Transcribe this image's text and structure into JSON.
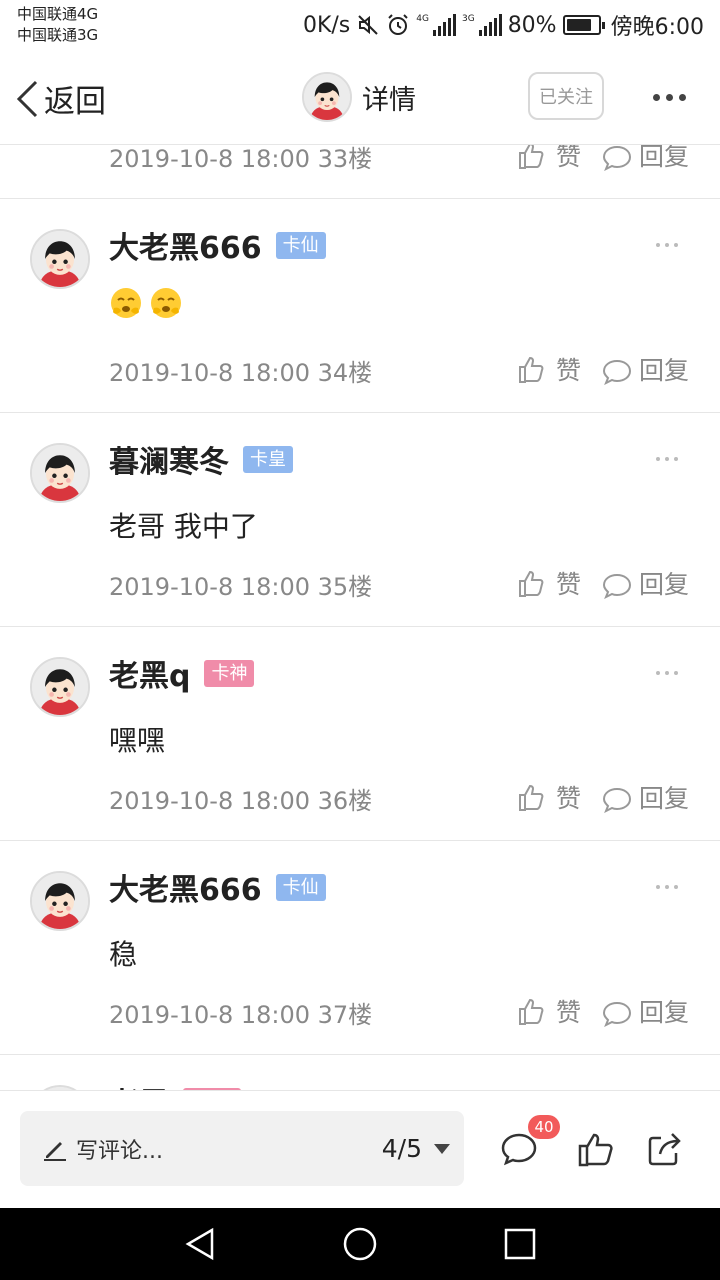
{
  "status_bar": {
    "carrier1": "中国联通4G",
    "carrier2": "中国联通3G",
    "net_speed": "0K/s",
    "signal1_tag": "4G",
    "signal2_tag": "3G",
    "battery": "80%",
    "battery_level": 0.8,
    "time": "傍晚6:00"
  },
  "nav": {
    "back_label": "返回",
    "title": "详情",
    "follow_label": "已关注"
  },
  "colors": {
    "badge_blue": "#8fb7ef",
    "badge_pink": "#f08ca9",
    "text_gray": "#888888",
    "count_badge": "#f25a5a"
  },
  "posts": [
    {
      "user": "",
      "badge": "",
      "content": "",
      "meta": "2019-10-8 18:00  33楼",
      "like": "赞",
      "reply": "回复"
    },
    {
      "user": "大老黑666",
      "badge": "卡仙",
      "badge_color": "blue",
      "content": "emoji:hushed-face,hushed-face",
      "meta": "2019-10-8 18:00  34楼",
      "like": "赞",
      "reply": "回复"
    },
    {
      "user": "暮澜寒冬",
      "badge": "卡皇",
      "badge_color": "blue",
      "content": "老哥 我中了",
      "meta": "2019-10-8 18:00  35楼",
      "like": "赞",
      "reply": "回复"
    },
    {
      "user": "老黑q",
      "badge": "卡神",
      "badge_color": "pink",
      "content": "嘿嘿",
      "meta": "2019-10-8 18:00  36楼",
      "like": "赞",
      "reply": "回复"
    },
    {
      "user": "大老黑666",
      "badge": "卡仙",
      "badge_color": "blue",
      "content": "稳",
      "meta": "2019-10-8 18:00  37楼",
      "like": "赞",
      "reply": "回复"
    },
    {
      "user": "老黑",
      "badge": "",
      "badge_color": "pink",
      "content": "",
      "meta": "",
      "like": "",
      "reply": ""
    }
  ],
  "bottom_bar": {
    "comment_placeholder": "写评论...",
    "page_indicator": "4/5",
    "comment_count": "40"
  }
}
